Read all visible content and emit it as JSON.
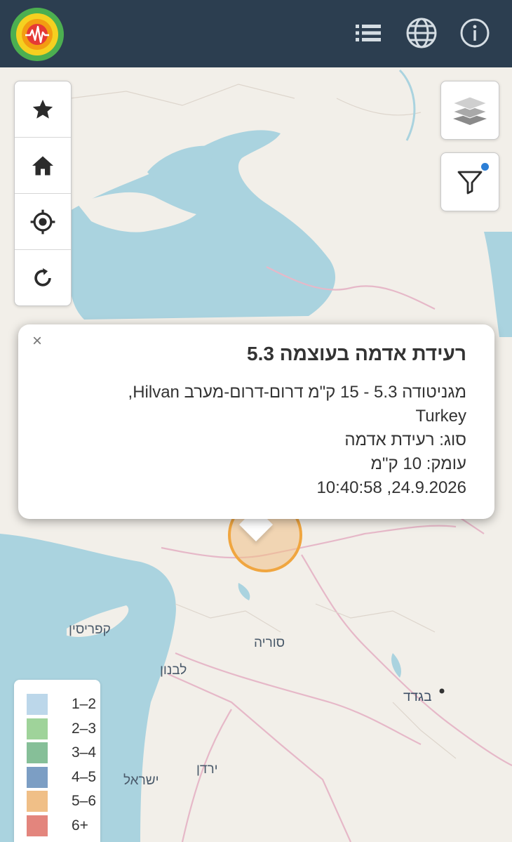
{
  "header": {
    "logo_icon": "seismograph-logo-icon",
    "list_icon": "list-icon",
    "globe_icon": "globe-icon",
    "info_icon": "info-icon"
  },
  "controls": {
    "favorites": "star-icon",
    "home": "home-icon",
    "locate": "crosshair-icon",
    "refresh": "refresh-icon",
    "layers": "layers-icon",
    "filter": "filter-icon"
  },
  "map_labels": {
    "cyprus": "קפריסין",
    "syria": "סוריה",
    "lebanon": "לבנון",
    "baghdad": "בגדד",
    "jordan": "ירדן",
    "israel": "ישראל"
  },
  "popup": {
    "close": "×",
    "title": "רעידת אדמה בעוצמה 5.3",
    "description_line1": "מגניטודה 5.3 - 15 ק\"מ דרום-דרום-מערב Hilvan,",
    "description_line2": "Turkey",
    "type": "סוג: רעידת אדמה",
    "depth": "עומק: 10 ק\"מ",
    "datetime": "24.9.2026, 10:40:58"
  },
  "legend": [
    {
      "label": "1–2",
      "color": "#bcd7ea"
    },
    {
      "label": "2–3",
      "color": "#9fd39a"
    },
    {
      "label": "3–4",
      "color": "#86bf98"
    },
    {
      "label": "4–5",
      "color": "#7c9ec4"
    },
    {
      "label": "5–6",
      "color": "#f0bf87"
    },
    {
      "label": "6+",
      "color": "#e3857d"
    }
  ],
  "colors": {
    "header_bg": "#2c3e50",
    "water": "#aad3df",
    "land": "#f2efe9",
    "marker": "#f0a640"
  }
}
